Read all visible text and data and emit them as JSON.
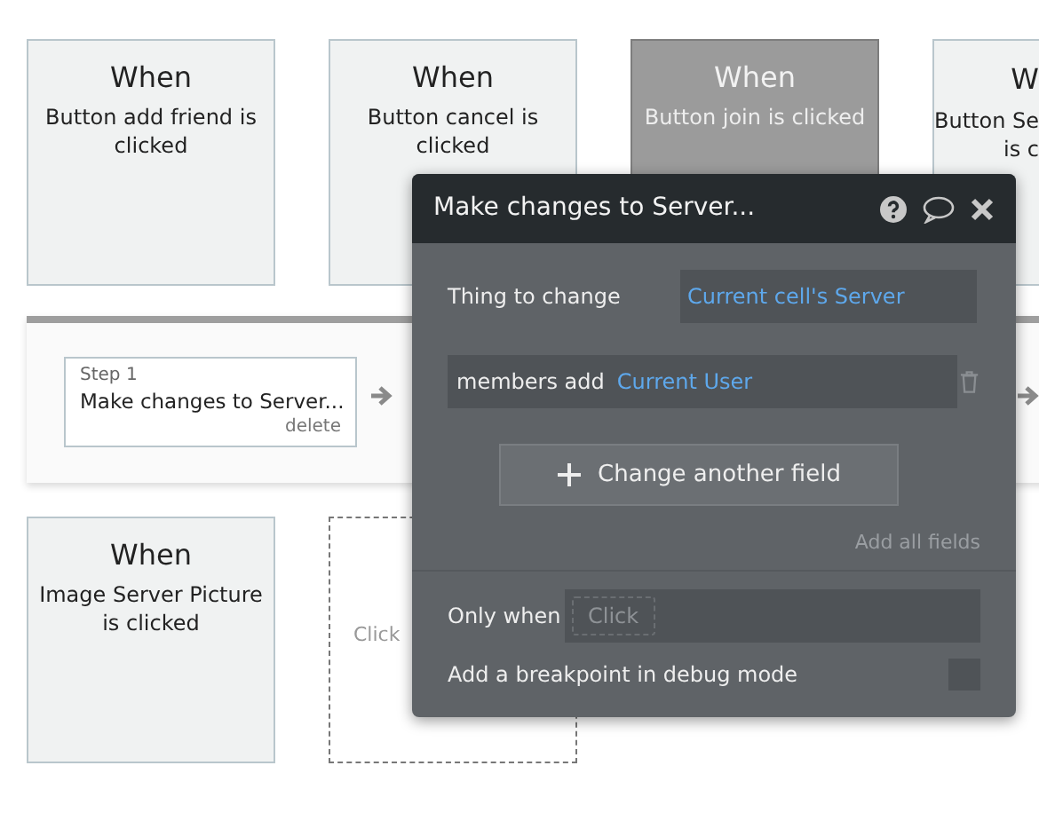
{
  "event_cards": [
    {
      "title": "When",
      "text": "Button add friend is clicked",
      "selected": false
    },
    {
      "title": "When",
      "text": "Button cancel is clicked",
      "selected": false
    },
    {
      "title": "When",
      "text": "Button join is clicked",
      "selected": true
    },
    {
      "title": "W",
      "text": "Button Se\nis c",
      "selected": false
    },
    {
      "title": "When",
      "text": "Image Server Picture is clicked",
      "selected": false
    }
  ],
  "step_bar": {
    "step_label": "Step 1",
    "step_title": "Make changes to Server...",
    "delete": "delete"
  },
  "empty_slot": {
    "text": "Click"
  },
  "popup": {
    "title": "Make changes to Server...",
    "thing_label": "Thing to change",
    "thing_value": "Current cell's Server",
    "changes": [
      {
        "field": "members add",
        "value": "Current User"
      }
    ],
    "add_button": "Change another field",
    "add_all": "Add all fields",
    "only_when_label": "Only when",
    "only_when_placeholder": "Click",
    "breakpoint_label": "Add a breakpoint in debug mode",
    "breakpoint_checked": false
  }
}
